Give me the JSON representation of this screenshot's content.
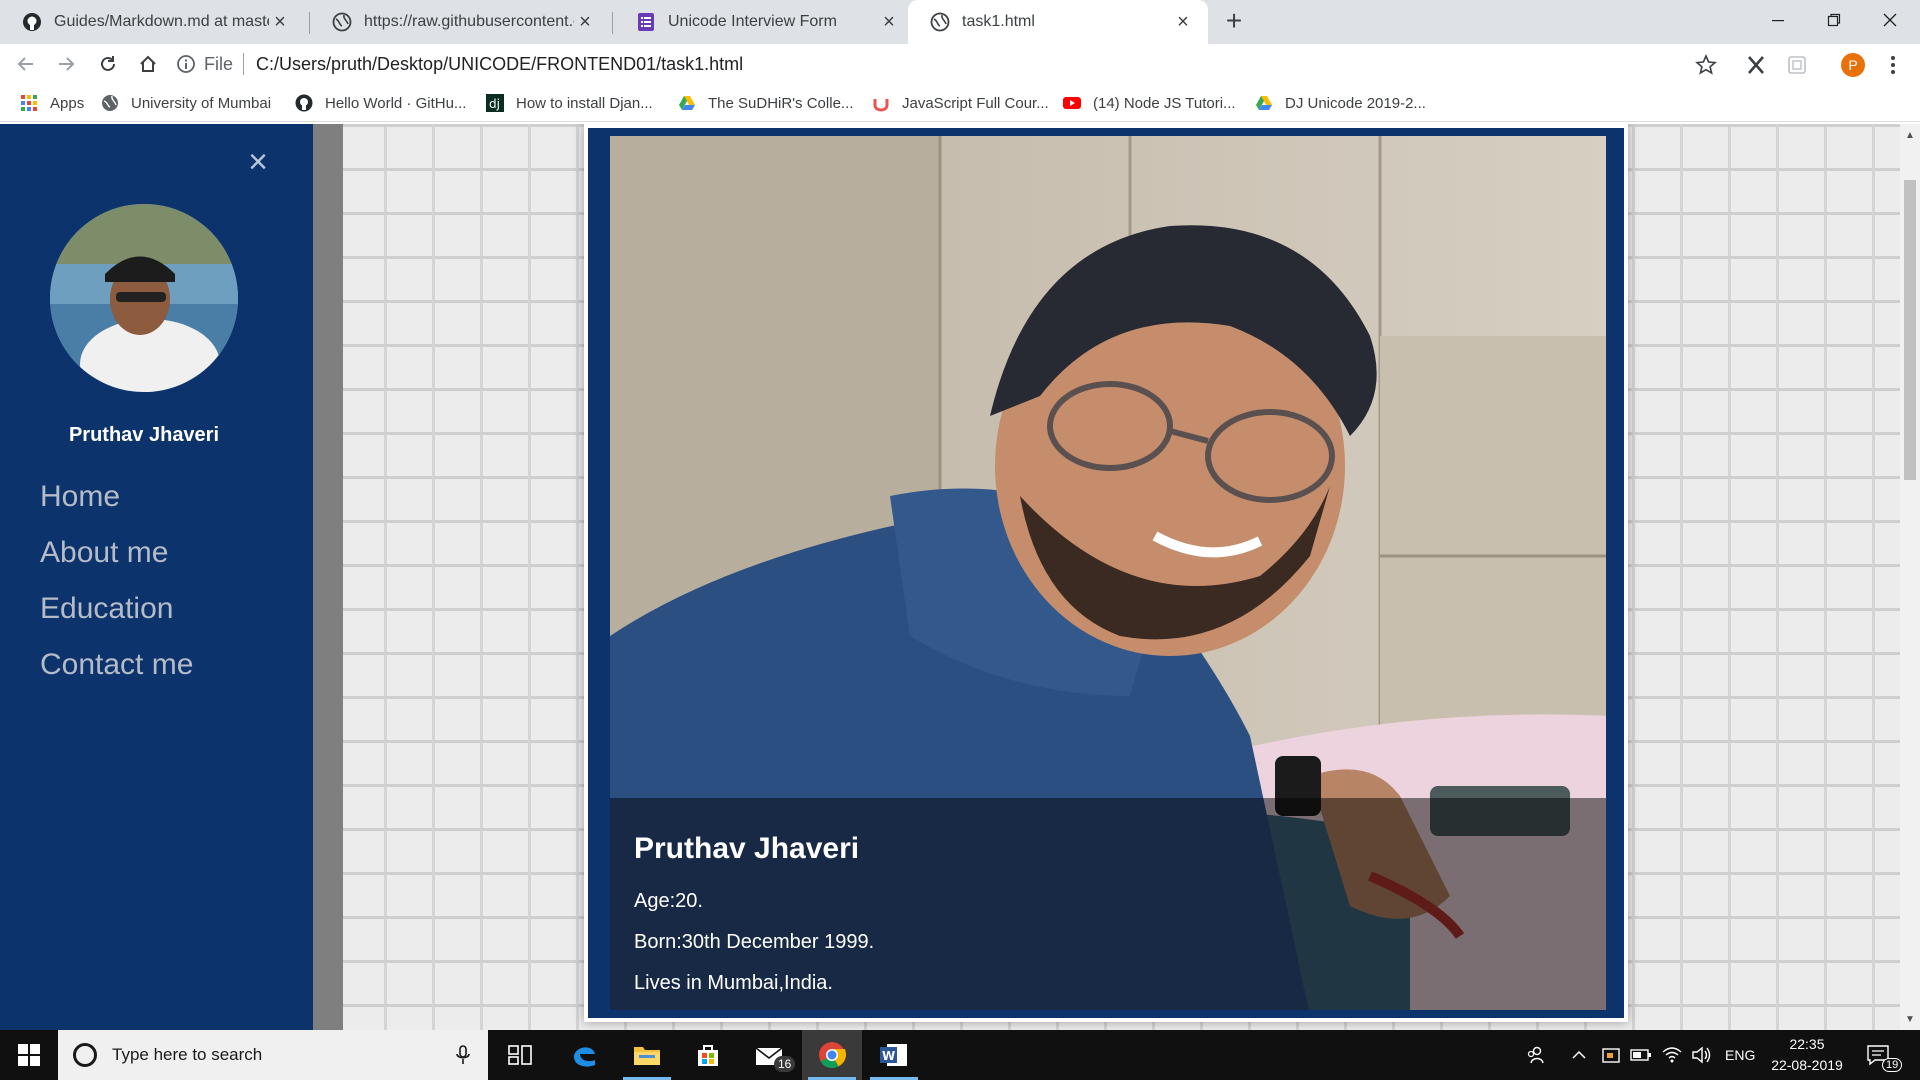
{
  "browser": {
    "tabs": [
      {
        "title": "Guides/Markdown.md at master",
        "icon": "github-icon",
        "active": false
      },
      {
        "title": "https://raw.githubusercontent.co",
        "icon": "globe-icon",
        "active": false
      },
      {
        "title": "Unicode Interview Form",
        "icon": "forms-icon",
        "active": false
      },
      {
        "title": "task1.html",
        "icon": "globe-icon",
        "active": true
      }
    ],
    "omnibox": {
      "scheme_label": "File",
      "url": "C:/Users/pruth/Desktop/UNICODE/FRONTEND01/task1.html"
    },
    "profile_initial": "P",
    "bookmarks": [
      {
        "label": "Apps",
        "icon": "apps-grid-icon"
      },
      {
        "label": "University of Mumbai",
        "icon": "globe-icon"
      },
      {
        "label": "Hello World · GitHu...",
        "icon": "github-icon"
      },
      {
        "label": "How to install Djan...",
        "icon": "django-icon"
      },
      {
        "label": "The SuDHiR's Colle...",
        "icon": "google-drive-icon"
      },
      {
        "label": "JavaScript Full Cour...",
        "icon": "udemy-icon"
      },
      {
        "label": "(14) Node JS Tutori...",
        "icon": "youtube-icon"
      },
      {
        "label": "DJ Unicode 2019-2...",
        "icon": "google-drive-icon"
      }
    ],
    "colors": {
      "tabstrip": "#dee1e6",
      "active_tab": "#ffffff"
    }
  },
  "page": {
    "sidebar": {
      "name": "Pruthav Jhaveri",
      "nav": [
        {
          "label": "Home"
        },
        {
          "label": "About me"
        },
        {
          "label": "Education"
        },
        {
          "label": "Contact me"
        }
      ],
      "colors": {
        "background": "#0c336b",
        "link": "#b5bcc7"
      }
    },
    "profile_card": {
      "name": "Pruthav Jhaveri",
      "age": "Age:20.",
      "born": "Born:30th December 1999.",
      "lives": "Lives in Mumbai,India."
    }
  },
  "taskbar": {
    "search_placeholder": "Type here to search",
    "mail_badge": "16",
    "language": "ENG",
    "time": "22:35",
    "date": "22-08-2019",
    "notification_count": "19"
  }
}
